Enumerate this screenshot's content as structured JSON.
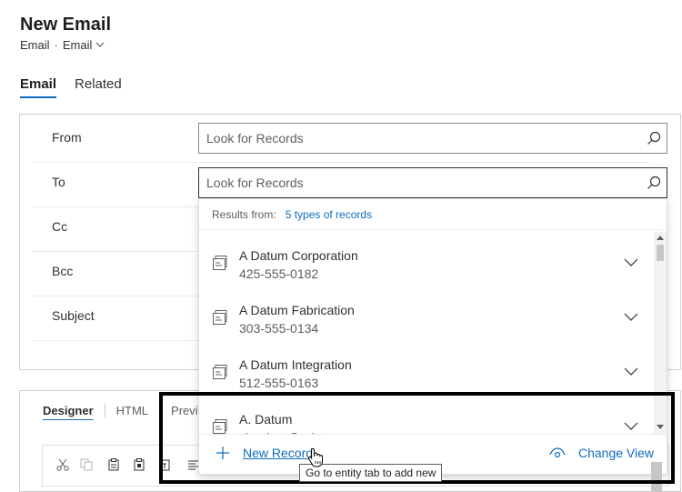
{
  "header": {
    "title": "New Email",
    "entity": "Email",
    "form": "Email"
  },
  "tabs": [
    {
      "label": "Email",
      "active": true
    },
    {
      "label": "Related",
      "active": false
    }
  ],
  "fields": {
    "from": {
      "label": "From",
      "placeholder": "Look for Records"
    },
    "to": {
      "label": "To",
      "placeholder": "Look for Records"
    },
    "cc": {
      "label": "Cc"
    },
    "bcc": {
      "label": "Bcc"
    },
    "subject": {
      "label": "Subject"
    }
  },
  "dropdown": {
    "results_label": "Results from:",
    "results_link": "5 types of records",
    "records": [
      {
        "name": "A Datum Corporation",
        "detail": "425-555-0182"
      },
      {
        "name": "A Datum Fabrication",
        "detail": "303-555-0134"
      },
      {
        "name": "A Datum Integration",
        "detail": "512-555-0163"
      },
      {
        "name": "A. Datum",
        "detail": "vlauriant@adatum.com"
      }
    ],
    "new_record": "New Record",
    "change_view": "Change View"
  },
  "designer": {
    "tabs": [
      "Designer",
      "HTML",
      "Preview"
    ]
  },
  "tooltip": "Go to entity tab to add new",
  "colors": {
    "accent": "#0f6cbd",
    "highlight": "#000000"
  }
}
